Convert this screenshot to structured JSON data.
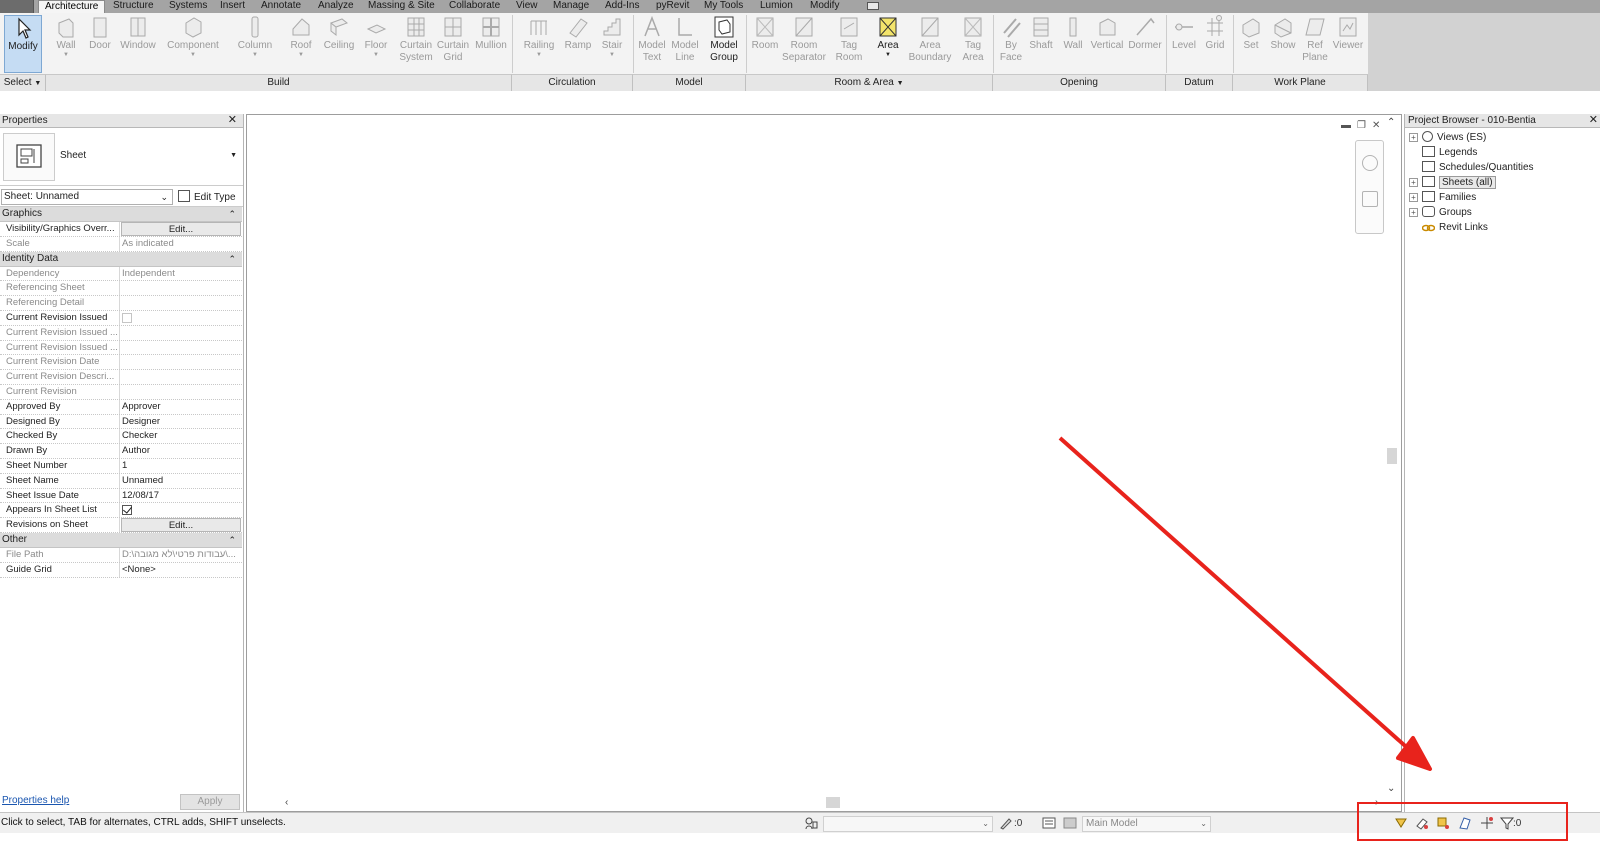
{
  "ribbon": {
    "tabs": [
      "Architecture",
      "Structure",
      "Systems",
      "Insert",
      "Annotate",
      "Analyze",
      "Massing & Site",
      "Collaborate",
      "View",
      "Manage",
      "Add-Ins",
      "pyRevit",
      "My Tools",
      "Lumion",
      "Modify"
    ],
    "active_tab": "Architecture",
    "buttons": {
      "modify": "Modify",
      "wall": "Wall",
      "door": "Door",
      "window": "Window",
      "component": "Component",
      "column": "Column",
      "roof": "Roof",
      "ceiling": "Ceiling",
      "floor": "Floor",
      "curtain_system": [
        "Curtain",
        "System"
      ],
      "curtain_grid": [
        "Curtain",
        "Grid"
      ],
      "mullion": "Mullion",
      "railing": "Railing",
      "ramp": "Ramp",
      "stair": "Stair",
      "model_text": [
        "Model",
        "Text"
      ],
      "model_line": [
        "Model",
        "Line"
      ],
      "model_group": [
        "Model",
        "Group"
      ],
      "room": "Room",
      "room_separator": [
        "Room",
        "Separator"
      ],
      "tag_room": [
        "Tag",
        "Room"
      ],
      "area": "Area",
      "area_boundary": [
        "Area",
        "Boundary"
      ],
      "tag_area": [
        "Tag",
        "Area"
      ],
      "by_face": [
        "By",
        "Face"
      ],
      "shaft": "Shaft",
      "wall_opening": "Wall",
      "vertical": "Vertical",
      "dormer": "Dormer",
      "level": "Level",
      "grid": "Grid",
      "set": "Set",
      "show": "Show",
      "ref_plane": [
        "Ref",
        "Plane"
      ],
      "viewer": "Viewer"
    },
    "panels": {
      "select": "Select",
      "build": "Build",
      "circulation": "Circulation",
      "model": "Model",
      "room_area": "Room & Area",
      "opening": "Opening",
      "datum": "Datum",
      "work_plane": "Work Plane"
    }
  },
  "properties": {
    "title": "Properties",
    "type_name": "Sheet",
    "instance_selector": "Sheet: Unnamed",
    "edit_type": "Edit Type",
    "groups": [
      {
        "name": "Graphics",
        "rows": [
          {
            "key": "Visibility/Graphics Overr...",
            "value": "Edit...",
            "kind": "button"
          },
          {
            "key": "Scale",
            "value": "As indicated",
            "kind": "disabled"
          }
        ]
      },
      {
        "name": "Identity Data",
        "rows": [
          {
            "key": "Dependency",
            "value": "Independent",
            "kind": "disabled"
          },
          {
            "key": "Referencing Sheet",
            "value": "",
            "kind": "disabled"
          },
          {
            "key": "Referencing Detail",
            "value": "",
            "kind": "disabled"
          },
          {
            "key": "Current Revision Issued",
            "value": "",
            "kind": "checkbox-off"
          },
          {
            "key": "Current Revision Issued ...",
            "value": "",
            "kind": "disabled"
          },
          {
            "key": "Current Revision Issued ...",
            "value": "",
            "kind": "disabled"
          },
          {
            "key": "Current Revision Date",
            "value": "",
            "kind": "disabled"
          },
          {
            "key": "Current Revision Descri...",
            "value": "",
            "kind": "disabled"
          },
          {
            "key": "Current Revision",
            "value": "",
            "kind": "disabled"
          },
          {
            "key": "Approved By",
            "value": "Approver",
            "kind": "text"
          },
          {
            "key": "Designed By",
            "value": "Designer",
            "kind": "text"
          },
          {
            "key": "Checked By",
            "value": "Checker",
            "kind": "text"
          },
          {
            "key": "Drawn By",
            "value": "Author",
            "kind": "text"
          },
          {
            "key": "Sheet Number",
            "value": "1",
            "kind": "text"
          },
          {
            "key": "Sheet Name",
            "value": "Unnamed",
            "kind": "text"
          },
          {
            "key": "Sheet Issue Date",
            "value": "12/08/17",
            "kind": "text"
          },
          {
            "key": "Appears In Sheet List",
            "value": "",
            "kind": "checkbox-on"
          },
          {
            "key": "Revisions on Sheet",
            "value": "Edit...",
            "kind": "button"
          }
        ]
      },
      {
        "name": "Other",
        "rows": [
          {
            "key": "File Path",
            "value": "D:\\עבודות פרטי\\לא מגובה\\...",
            "kind": "disabled"
          },
          {
            "key": "Guide Grid",
            "value": "<None>",
            "kind": "text"
          }
        ]
      }
    ],
    "help_link": "Properties help",
    "apply": "Apply"
  },
  "browser": {
    "title": "Project Browser - 010-Bentia",
    "nodes": [
      {
        "label": "Views (ES)",
        "expander": "+",
        "icon": "views-icon"
      },
      {
        "label": "Legends",
        "expander": "",
        "icon": "legends-icon"
      },
      {
        "label": "Schedules/Quantities",
        "expander": "",
        "icon": "schedules-icon"
      },
      {
        "label": "Sheets (all)",
        "expander": "+",
        "icon": "sheets-icon",
        "highlight": true
      },
      {
        "label": "Families",
        "expander": "+",
        "icon": "families-icon"
      },
      {
        "label": "Groups",
        "expander": "+",
        "icon": "groups-icon"
      },
      {
        "label": "Revit Links",
        "expander": "",
        "icon": "revit-links-icon"
      }
    ]
  },
  "status": {
    "message": "Click to select, TAB for alternates, CTRL adds, SHIFT unselects.",
    "editable_count": ":0",
    "model": "Main Model",
    "filter_count": ":0"
  },
  "colors": {
    "highlight_red": "#e8231c",
    "tab_active_bg": "#f5f5f5",
    "selected_tool_bg": "#c5dcf3"
  }
}
